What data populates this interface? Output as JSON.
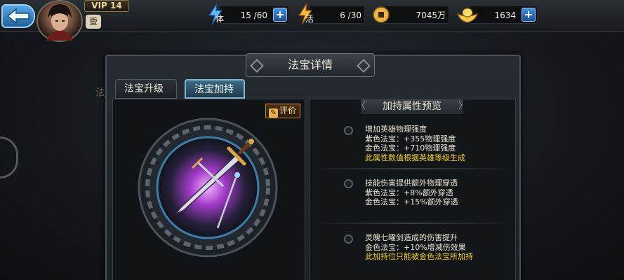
{
  "header": {
    "vip": "VIP 14",
    "level_char": "壹",
    "stamina": {
      "label": "体",
      "value": "15 /60"
    },
    "vitality": {
      "label": "活",
      "value": "6 /30"
    },
    "coins": {
      "value": "7045万"
    },
    "ingots": {
      "value": "1634"
    },
    "plus_label": "+"
  },
  "left_margin": {
    "ghost_tab": "法"
  },
  "panel": {
    "title": "法宝详情",
    "tabs": [
      "法宝升级",
      "法宝加持"
    ],
    "active_tab": 1,
    "review_label": "评价",
    "preview_header": "加持属性预览"
  },
  "attributes": [
    {
      "title": "增加英雄物理强度",
      "lines": [
        "紫色法宝：+355物理强度",
        "金色法宝：+710物理强度"
      ],
      "note": "此属性数值根据英雄等级生成"
    },
    {
      "title": "技能伤害提供额外物理穿透",
      "lines": [
        "紫色法宝：+8%额外穿透",
        "金色法宝：+15%额外穿透"
      ],
      "note": ""
    },
    {
      "title": "灵魄七曜剑造成的伤害提升",
      "lines": [
        "金色法宝：+10%增减伤效果"
      ],
      "note": "此加持位只能被金色法宝所加持"
    }
  ],
  "colors": {
    "accent_blue": "#3f8fe0",
    "highlight_yellow": "#f2cf1e",
    "active_tab": "#3b6b84"
  },
  "icons": {
    "back": "back-arrow-icon",
    "stamina": "lightning-icon",
    "vitality": "lightning-icon",
    "coins": "coin-icon",
    "ingots": "gold-ingot-icon",
    "review": "pencil-icon"
  }
}
